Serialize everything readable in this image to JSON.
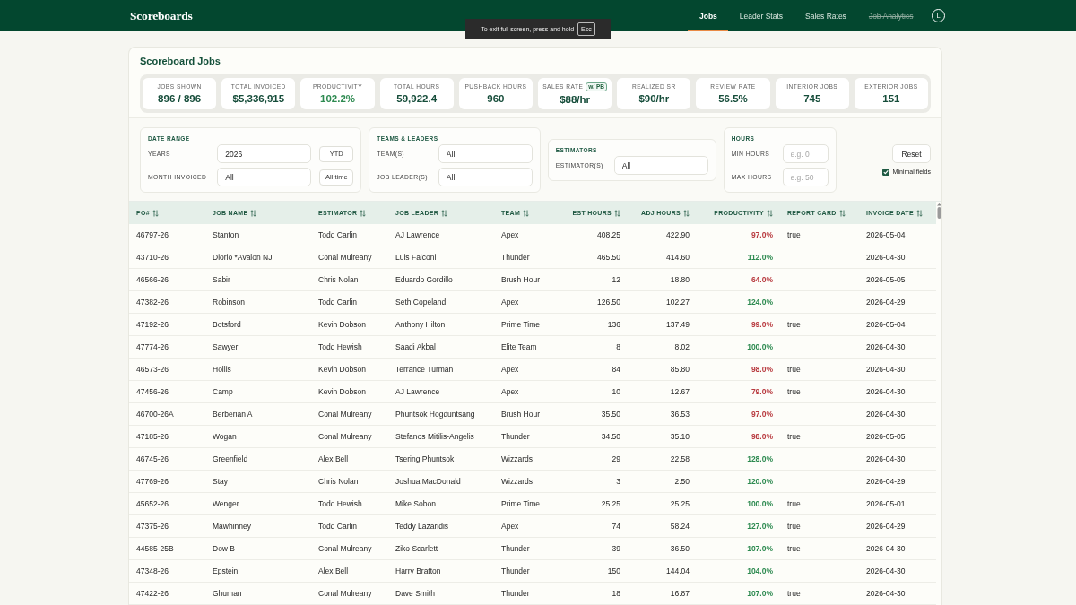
{
  "nav": {
    "logo": "Scoreboards",
    "links": [
      {
        "label": "Jobs",
        "selected": true,
        "disabled": false
      },
      {
        "label": "Leader Stats",
        "selected": false,
        "disabled": false
      },
      {
        "label": "Sales Rates",
        "selected": false,
        "disabled": false
      },
      {
        "label": "Job Analytics",
        "selected": false,
        "disabled": true
      }
    ],
    "avatar": "L"
  },
  "fullscreen_notice": {
    "text": "To exit full screen, press and hold",
    "key": "Esc"
  },
  "title": "Scoreboard Jobs",
  "stats": [
    {
      "label": "JOBS SHOWN",
      "value": "896 / 896",
      "color": "#164d3a"
    },
    {
      "label": "TOTAL INVOICED",
      "value": "$5,336,915",
      "color": "#164d3a"
    },
    {
      "label": "PRODUCTIVITY",
      "value": "102.2%",
      "color": "#2d8a50"
    },
    {
      "label": "TOTAL HOURS",
      "value": "59,922.4",
      "color": "#164d3a"
    },
    {
      "label": "PUSHBACK HOURS",
      "value": "960",
      "color": "#164d3a"
    },
    {
      "label": "SALES RATE",
      "badge": "w/ PB",
      "value": "$88/hr",
      "color": "#164d3a"
    },
    {
      "label": "REALIZED SR",
      "value": "$90/hr",
      "color": "#164d3a"
    },
    {
      "label": "REVIEW RATE",
      "value": "56.5%",
      "color": "#164d3a"
    },
    {
      "label": "INTERIOR JOBS",
      "value": "745",
      "color": "#164d3a"
    },
    {
      "label": "EXTERIOR JOBS",
      "value": "151",
      "color": "#164d3a"
    }
  ],
  "filters": {
    "groups": [
      {
        "title": "DATE RANGE",
        "fields": [
          {
            "label": "YEARS",
            "value": "2026",
            "button": "YTD"
          },
          {
            "label": "MONTH INVOICED",
            "value": "All",
            "button": "All time"
          }
        ]
      },
      {
        "title": "TEAMS & LEADERS",
        "fields": [
          {
            "label": "TEAM(S)",
            "value": "All"
          },
          {
            "label": "JOB LEADER(S)",
            "value": "All"
          }
        ]
      },
      {
        "title": "ESTIMATORS",
        "fields": [
          {
            "label": "ESTIMATOR(S)",
            "value": "All"
          }
        ]
      },
      {
        "title": "HOURS",
        "fields": [
          {
            "label": "MIN HOURS",
            "placeholder": "e.g. 0"
          },
          {
            "label": "MAX HOURS",
            "placeholder": "e.g. 50"
          }
        ]
      }
    ],
    "reset_button": "Reset",
    "minimal_fields": {
      "label": "Minimal fields",
      "checked": true
    }
  },
  "table": {
    "columns": [
      "PO#",
      "JOB NAME",
      "ESTIMATOR",
      "JOB LEADER",
      "TEAM",
      "EST HOURS",
      "ADJ HOURS",
      "PRODUCTIVITY",
      "REPORT CARD",
      "INVOICE DATE"
    ],
    "rows": [
      {
        "po": "46797-26",
        "job_name": "Stanton",
        "estimator": "Todd Carlin",
        "job_leader": "AJ Lawrence",
        "team": "Apex",
        "est_hours": "408.25",
        "adj_hours": "422.90",
        "productivity": "97.0%",
        "color": "#b83a3f",
        "report_card": "true",
        "invoice_date": "2026-05-04"
      },
      {
        "po": "43710-26",
        "job_name": "Diorio *Avalon NJ",
        "estimator": "Conal Mulreany",
        "job_leader": "Luis Falconi",
        "team": "Thunder",
        "est_hours": "465.50",
        "adj_hours": "414.60",
        "productivity": "112.0%",
        "color": "#2d8a50",
        "invoice_date": "2026-04-30"
      },
      {
        "po": "46566-26",
        "job_name": "Sabir",
        "estimator": "Chris Nolan",
        "job_leader": "Eduardo Gordillo",
        "team": "Brush Hour",
        "est_hours": "12",
        "adj_hours": "18.80",
        "productivity": "64.0%",
        "color": "#b83a3f",
        "invoice_date": "2026-05-05"
      },
      {
        "po": "47382-26",
        "job_name": "Robinson",
        "estimator": "Todd Carlin",
        "job_leader": "Seth Copeland",
        "team": "Apex",
        "est_hours": "126.50",
        "adj_hours": "102.27",
        "productivity": "124.0%",
        "color": "#2d8a50",
        "invoice_date": "2026-04-29"
      },
      {
        "po": "47192-26",
        "job_name": "Botsford",
        "estimator": "Kevin Dobson",
        "job_leader": "Anthony Hilton",
        "team": "Prime Time",
        "est_hours": "136",
        "adj_hours": "137.49",
        "productivity": "99.0%",
        "color": "#b83a3f",
        "report_card": "true",
        "invoice_date": "2026-05-04"
      },
      {
        "po": "47774-26",
        "job_name": "Sawyer",
        "estimator": "Todd Hewish",
        "job_leader": "Saadi Akbal",
        "team": "Elite Team",
        "est_hours": "8",
        "adj_hours": "8.02",
        "productivity": "100.0%",
        "color": "#2d8a50",
        "invoice_date": "2026-04-30"
      },
      {
        "po": "46573-26",
        "job_name": "Hollis",
        "estimator": "Kevin Dobson",
        "job_leader": "Terrance Turman",
        "team": "Apex",
        "est_hours": "84",
        "adj_hours": "85.80",
        "productivity": "98.0%",
        "color": "#b83a3f",
        "report_card": "true",
        "invoice_date": "2026-04-30"
      },
      {
        "po": "47456-26",
        "job_name": "Camp",
        "estimator": "Kevin Dobson",
        "job_leader": "AJ Lawrence",
        "team": "Apex",
        "est_hours": "10",
        "adj_hours": "12.67",
        "productivity": "79.0%",
        "color": "#b83a3f",
        "report_card": "true",
        "invoice_date": "2026-04-30"
      },
      {
        "po": "46700-26A",
        "job_name": "Berberian A",
        "estimator": "Conal Mulreany",
        "job_leader": "Phuntsok Hogduntsang",
        "team": "Brush Hour",
        "est_hours": "35.50",
        "adj_hours": "36.53",
        "productivity": "97.0%",
        "color": "#b83a3f",
        "invoice_date": "2026-04-30"
      },
      {
        "po": "47185-26",
        "job_name": "Wogan",
        "estimator": "Conal Mulreany",
        "job_leader": "Stefanos Mitilis-Angelis",
        "team": "Thunder",
        "est_hours": "34.50",
        "adj_hours": "35.10",
        "productivity": "98.0%",
        "color": "#b83a3f",
        "report_card": "true",
        "invoice_date": "2026-05-05"
      },
      {
        "po": "46745-26",
        "job_name": "Greenfield",
        "estimator": "Alex Bell",
        "job_leader": "Tsering Phuntsok",
        "team": "Wizzards",
        "est_hours": "29",
        "adj_hours": "22.58",
        "productivity": "128.0%",
        "color": "#2d8a50",
        "invoice_date": "2026-04-30"
      },
      {
        "po": "47769-26",
        "job_name": "Stay",
        "estimator": "Chris Nolan",
        "job_leader": "Joshua MacDonald",
        "team": "Wizzards",
        "est_hours": "3",
        "adj_hours": "2.50",
        "productivity": "120.0%",
        "color": "#2d8a50",
        "invoice_date": "2026-04-29"
      },
      {
        "po": "45652-26",
        "job_name": "Wenger",
        "estimator": "Todd Hewish",
        "job_leader": "Mike Sobon",
        "team": "Prime Time",
        "est_hours": "25.25",
        "adj_hours": "25.25",
        "productivity": "100.0%",
        "color": "#2d8a50",
        "report_card": "true",
        "invoice_date": "2026-05-01"
      },
      {
        "po": "47375-26",
        "job_name": "Mawhinney",
        "estimator": "Todd Carlin",
        "job_leader": "Teddy Lazaridis",
        "team": "Apex",
        "est_hours": "74",
        "adj_hours": "58.24",
        "productivity": "127.0%",
        "color": "#2d8a50",
        "report_card": "true",
        "invoice_date": "2026-04-29"
      },
      {
        "po": "44585-25B",
        "job_name": "Dow B",
        "estimator": "Conal Mulreany",
        "job_leader": "Ziko Scarlett",
        "team": "Thunder",
        "est_hours": "39",
        "adj_hours": "36.50",
        "productivity": "107.0%",
        "color": "#2d8a50",
        "report_card": "true",
        "invoice_date": "2026-04-30"
      },
      {
        "po": "47348-26",
        "job_name": "Epstein",
        "estimator": "Alex Bell",
        "job_leader": "Harry Bratton",
        "team": "Thunder",
        "est_hours": "150",
        "adj_hours": "144.04",
        "productivity": "104.0%",
        "color": "#2d8a50",
        "invoice_date": "2026-04-30"
      },
      {
        "po": "47422-26",
        "job_name": "Ghuman",
        "estimator": "Conal Mulreany",
        "job_leader": "Dave Smith",
        "team": "Thunder",
        "est_hours": "18",
        "adj_hours": "16.87",
        "productivity": "107.0%",
        "color": "#2d8a50",
        "report_card": "true",
        "invoice_date": "2026-04-30"
      }
    ]
  }
}
